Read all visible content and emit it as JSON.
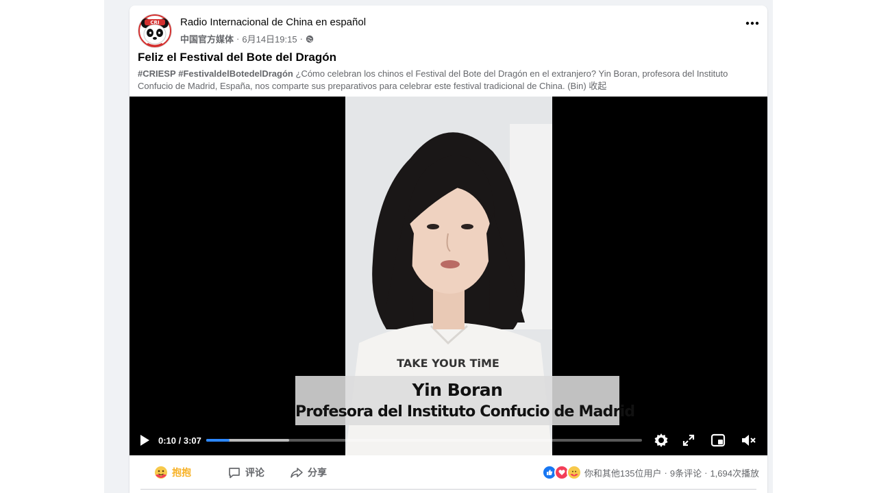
{
  "post": {
    "page_name": "Radio Internacional de China en español",
    "page_label": "中国官方媒体",
    "separator": "·",
    "date": "6月14日19:15",
    "title": "Feliz el Festival del Bote del Dragón",
    "hashtag1": "#CRIESP",
    "hashtag2": "#FestivaldelBotedelDragón",
    "body": "¿Cómo celebran los chinos el Festival del Bote del Dragón en el extranjero? Yin Boran, profesora del Instituto Confucio de Madrid, España, nos comparte sus preparativos para celebrar este festival tradicional de China. (Bin)",
    "collapse": "收起"
  },
  "video": {
    "caption_name": "Yin Boran",
    "caption_role": "Profesora del Instituto Confucio de Madrid",
    "shirt_text": "TAKE YOUR TiME",
    "time_display": "0:10 / 3:07",
    "progress_fraction": 0.054,
    "buffered_fraction": 0.19
  },
  "actions": {
    "hug_label": "抱抱",
    "comment_label": "评论",
    "share_label": "分享"
  },
  "stats": {
    "reactions_text": "你和其他135位用户",
    "comments_text": "9条评论",
    "views_text": "1,694次播放",
    "dot": "·"
  },
  "icons": {
    "avatar": "panda-logo-icon",
    "audience": "globe-icon",
    "more": "more-options-icon",
    "play": "play-icon",
    "settings": "gear-icon",
    "fullscreen": "fullscreen-icon",
    "pip": "picture-in-picture-icon",
    "mute": "muted-speaker-icon"
  },
  "colors": {
    "accent": "#2d88ff",
    "hug": "#f7b125",
    "like": "#1877f2",
    "love": "#f33e58"
  }
}
